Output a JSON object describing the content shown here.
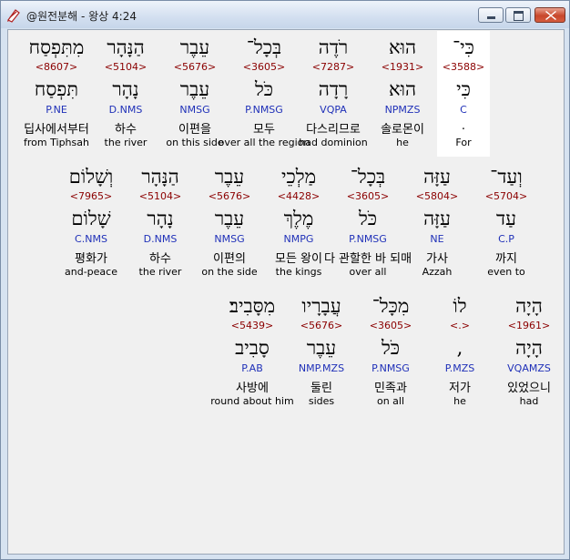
{
  "window": {
    "title": "@원전분해 - 왕상 4:24"
  },
  "colors": {
    "strong_number": "#8b0000",
    "morph_code": "#1f30b8",
    "selected_background": "#ffffff",
    "content_background": "#f0f0f0"
  },
  "icons": {
    "app": "bible-app-icon",
    "minimize": "minimize-icon",
    "maximize": "maximize-icon",
    "close": "close-icon"
  },
  "lines": [
    [
      {
        "hebrew": "כִּי־",
        "strong": "<3588>",
        "lemma": "כִּי",
        "morph": "C",
        "korean": ".",
        "english": "For"
      },
      {
        "hebrew": "הוּא",
        "strong": "<1931>",
        "lemma": "הוּא",
        "morph": "NPMZS",
        "korean": "솔로몬이",
        "english": "he"
      },
      {
        "hebrew": "רֹדֶה",
        "strong": "<7287>",
        "lemma": "רָדָה",
        "morph": "VQPA",
        "korean": "다스리므로",
        "english": "had dominion"
      },
      {
        "hebrew": "בְּכָל־",
        "strong": "<3605>",
        "lemma": "כֹּל",
        "morph": "P.NMSG",
        "korean": "모두",
        "english": "over all the region"
      },
      {
        "hebrew": "עֵבֶר",
        "strong": "<5676>",
        "lemma": "עֵבֶר",
        "morph": "NMSG",
        "korean": "이편을",
        "english": "on this side"
      },
      {
        "hebrew": "הַנָּהָר",
        "strong": "<5104>",
        "lemma": "נָהָר",
        "morph": "D.NMS",
        "korean": "하수",
        "english": "the river"
      },
      {
        "hebrew": "מִתִּפְסַח",
        "strong": "<8607>",
        "lemma": "תִּפְסַח",
        "morph": "P.NE",
        "korean": "딥사에서부터",
        "english": "from Tiphsah"
      }
    ],
    [
      {
        "hebrew": "וְעַד־",
        "strong": "<5704>",
        "lemma": "עַד",
        "morph": "C.P",
        "korean": "까지",
        "english": "even to"
      },
      {
        "hebrew": "עַזָּה",
        "strong": "<5804>",
        "lemma": "עַזָּה",
        "morph": "NE",
        "korean": "가사",
        "english": "Azzah"
      },
      {
        "hebrew": "בְּכָל־",
        "strong": "<3605>",
        "lemma": "כֹּל",
        "morph": "P.NMSG",
        "korean": "다 관할한 바 되매",
        "english": "over all"
      },
      {
        "hebrew": "מַלְכֵי",
        "strong": "<4428>",
        "lemma": "מֶלֶךְ",
        "morph": "NMPG",
        "korean": "모든 왕이",
        "english": "the kings"
      },
      {
        "hebrew": "עֵבֶר",
        "strong": "<5676>",
        "lemma": "עֵבֶר",
        "morph": "NMSG",
        "korean": "이편의",
        "english": "on the side"
      },
      {
        "hebrew": "הַנָּהָר",
        "strong": "<5104>",
        "lemma": "נָהָר",
        "morph": "D.NMS",
        "korean": "하수",
        "english": "the river"
      },
      {
        "hebrew": "וְשָׁלוֹם",
        "strong": "<7965>",
        "lemma": "שָׁלוֹם",
        "morph": "C.NMS",
        "korean": "평화가",
        "english": "and-peace"
      }
    ],
    [
      {
        "hebrew": "הָיָה",
        "strong": "<1961>",
        "lemma": "הָיָה",
        "morph": "VQAMZS",
        "korean": "있었으니",
        "english": "had"
      },
      {
        "hebrew": "לוֹ",
        "strong": "<.>",
        "lemma": ",",
        "morph": "P.MZS",
        "korean": "저가",
        "english": "he"
      },
      {
        "hebrew": "מִכָּל־",
        "strong": "<3605>",
        "lemma": "כֹּל",
        "morph": "P.NMSG",
        "korean": "민족과",
        "english": "on all"
      },
      {
        "hebrew": "עֲבָרָיו",
        "strong": "<5676>",
        "lemma": "עֵבֶר",
        "morph": "NMP.MZS",
        "korean": "둘린",
        "english": "sides"
      },
      {
        "hebrew": "מִסָּבִיב׃",
        "strong": "<5439>",
        "lemma": "סָבִיב",
        "morph": "P.AB",
        "korean": "사방에",
        "english": "round about him"
      }
    ]
  ]
}
